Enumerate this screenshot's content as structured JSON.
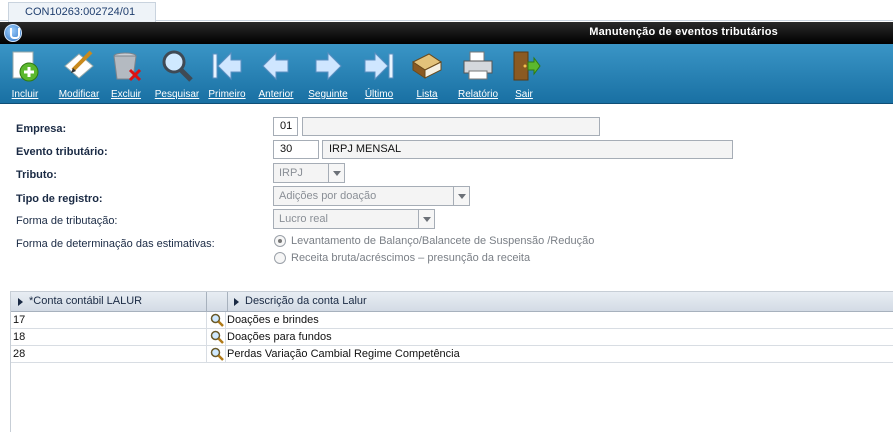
{
  "tab": {
    "label": "CON10263:002724/01"
  },
  "window": {
    "title": "Manutenção de eventos tributários"
  },
  "colors": {
    "toolbar": "#2a86bb",
    "title_bar": "#111111",
    "grid_header": "#dde3ea"
  },
  "toolbar": {
    "buttons": [
      {
        "id": "incluir",
        "label": "Incluir",
        "icon": "add-doc-icon"
      },
      {
        "id": "modificar",
        "label": "Modificar",
        "icon": "edit-doc-icon"
      },
      {
        "id": "excluir",
        "label": "Excluir",
        "icon": "trash-icon"
      },
      {
        "id": "pesquisar",
        "label": "Pesquisar",
        "icon": "magnifier-icon"
      },
      {
        "id": "primeiro",
        "label": "Primeiro",
        "icon": "first-arrow-icon"
      },
      {
        "id": "anterior",
        "label": "Anterior",
        "icon": "prev-arrow-icon"
      },
      {
        "id": "seguinte",
        "label": "Seguinte",
        "icon": "next-arrow-icon"
      },
      {
        "id": "ultimo",
        "label": "Último",
        "icon": "last-arrow-icon"
      },
      {
        "id": "lista",
        "label": "Lista",
        "icon": "book-icon"
      },
      {
        "id": "relatorio",
        "label": "Relatório",
        "icon": "printer-icon"
      },
      {
        "id": "sair",
        "label": "Sair",
        "icon": "exit-door-icon"
      }
    ]
  },
  "form": {
    "empresa": {
      "label": "Empresa:",
      "code": "01",
      "name": ""
    },
    "evento": {
      "label": "Evento tributário:",
      "code": "30",
      "name": "IRPJ MENSAL"
    },
    "tributo": {
      "label": "Tributo:",
      "value": "IRPJ"
    },
    "tipo_registro": {
      "label": "Tipo de registro:",
      "value": "Adições por doação"
    },
    "forma_tributacao": {
      "label": "Forma de tributação:",
      "value": "Lucro real"
    },
    "forma_estimativas": {
      "label": "Forma de determinação das estimativas:",
      "options": [
        {
          "label": "Levantamento de Balanço/Balancete de Suspensão  /Redução",
          "selected": true
        },
        {
          "label": "Receita bruta/acréscimos – presunção da receita",
          "selected": false
        }
      ]
    }
  },
  "grid": {
    "columns": [
      "*Conta contábil LALUR",
      "Descrição da conta Lalur"
    ],
    "rows": [
      {
        "code": "17",
        "desc": "Doações e brindes"
      },
      {
        "code": "18",
        "desc": "Doações para fundos"
      },
      {
        "code": "28",
        "desc": "Perdas Variação Cambial Regime Competência"
      }
    ]
  }
}
